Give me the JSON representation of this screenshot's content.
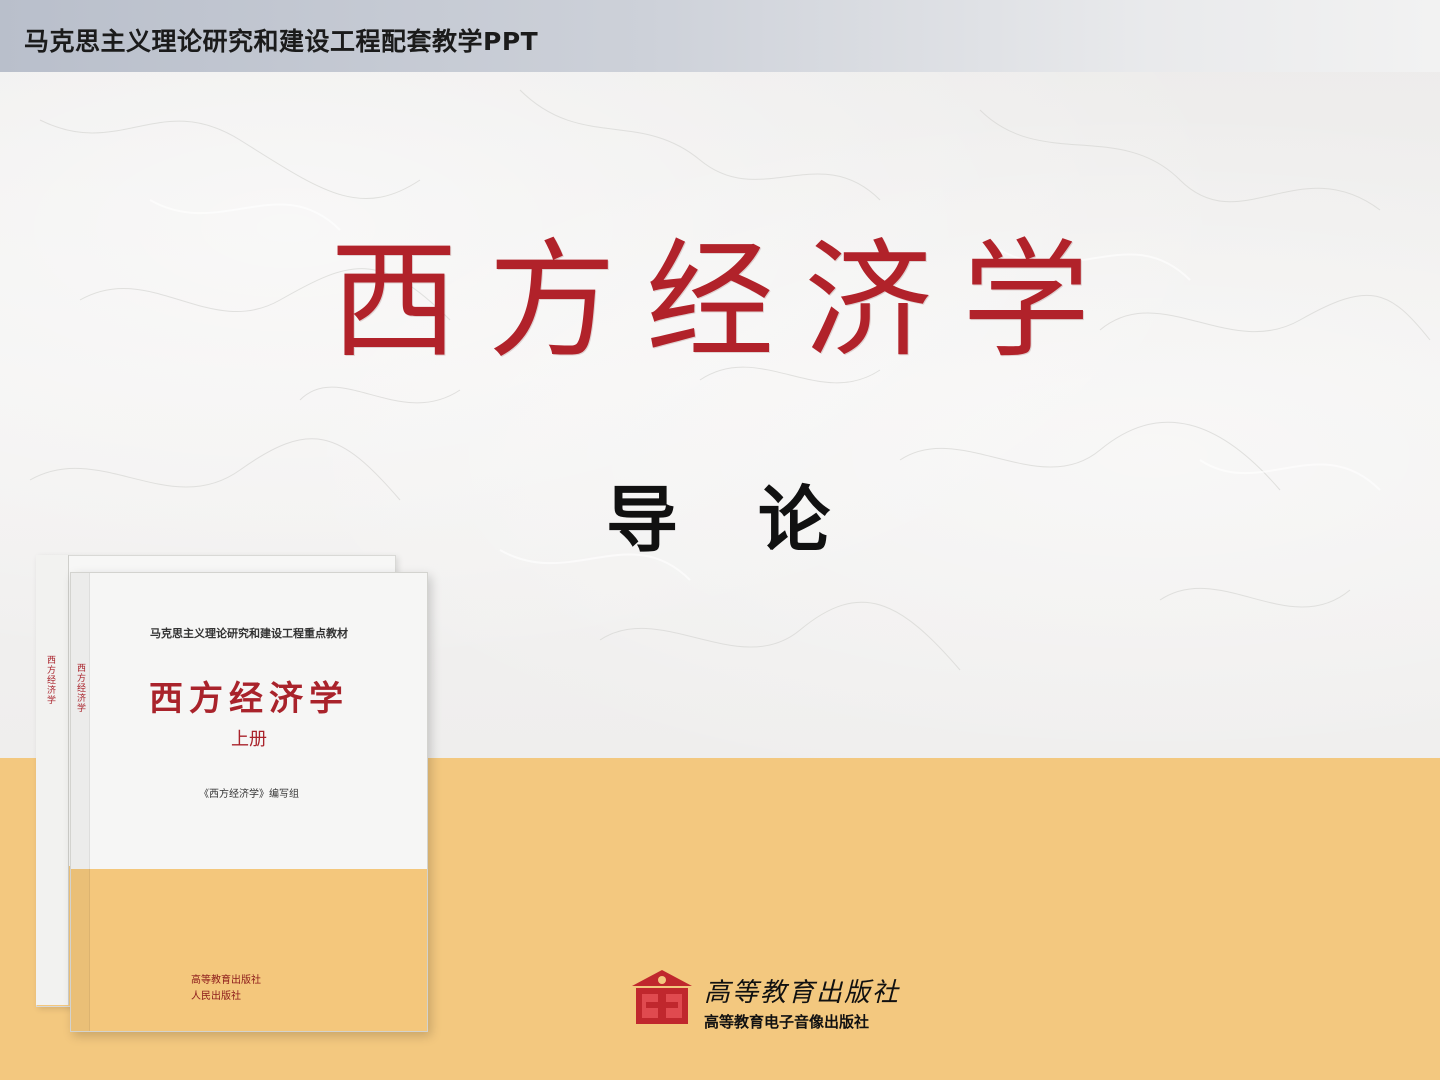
{
  "header": {
    "series_title": "马克思主义理论研究和建设工程配套教学PPT"
  },
  "slide": {
    "title": "西方经济学",
    "subtitle": "导论"
  },
  "book": {
    "series": "马克思主义理论研究和建设工程重点教材",
    "title": "西方经济学",
    "volume": "上册",
    "editor": "《西方经济学》编写组",
    "spine_title": "西方经济学",
    "publisher_line_1": "高等教育出版社",
    "publisher_line_2": "人民出版社"
  },
  "publisher": {
    "name_calligraphy": "高等教育出版社",
    "name_full": "高等教育电子音像出版社"
  },
  "colors": {
    "title_red": "#b1222a",
    "band_gold": "#f3c87f",
    "header_band": "#c3c8d2"
  }
}
